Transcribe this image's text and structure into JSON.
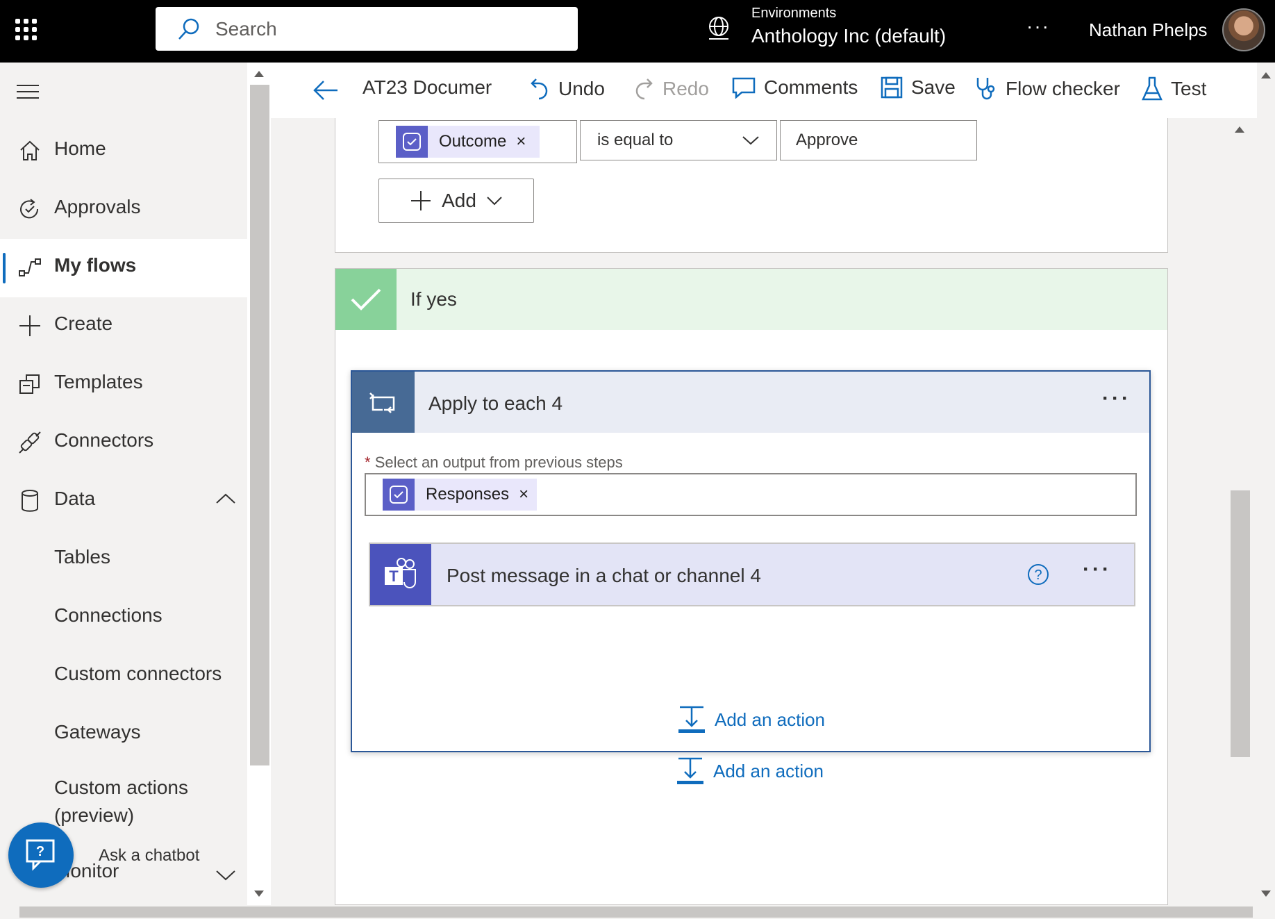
{
  "topbar": {
    "search_placeholder": "Search",
    "environment_label": "Environments",
    "environment_name": "Anthology Inc (default)",
    "more": "···",
    "user_name": "Nathan Phelps"
  },
  "sidebar": {
    "items": [
      {
        "label": "Home",
        "icon": "home-icon"
      },
      {
        "label": "Approvals",
        "icon": "approvals-icon"
      },
      {
        "label": "My flows",
        "icon": "flows-icon",
        "active": true
      },
      {
        "label": "Create",
        "icon": "plus-icon"
      },
      {
        "label": "Templates",
        "icon": "templates-icon"
      },
      {
        "label": "Connectors",
        "icon": "connectors-icon"
      },
      {
        "label": "Data",
        "icon": "database-icon",
        "expanded": true
      }
    ],
    "data_children": [
      "Tables",
      "Connections",
      "Custom connectors",
      "Gateways",
      "Custom actions (preview)"
    ],
    "monitor_label": "Monitor",
    "chatbot_label": "Ask a chatbot"
  },
  "toolbar": {
    "flow_name": "AT23 Documer",
    "undo": "Undo",
    "redo": "Redo",
    "comments": "Comments",
    "save": "Save",
    "flow_checker": "Flow checker",
    "test": "Test"
  },
  "condition": {
    "token_label": "Outcome",
    "operator": "is equal to",
    "value": "Approve",
    "add_label": "Add"
  },
  "if_yes": {
    "title": "If yes",
    "apply_each": {
      "title": "Apply to each 4",
      "field_label": "Select an output from previous steps",
      "token_label": "Responses",
      "action_title": "Post message in a chat or channel 4",
      "add_action_label": "Add an action"
    },
    "add_action_label": "Add an action"
  },
  "colors": {
    "accent": "#0f6cbd",
    "yes_green": "#88d29a",
    "loop_blue": "#476a95",
    "teams_purple": "#4b53bc"
  }
}
